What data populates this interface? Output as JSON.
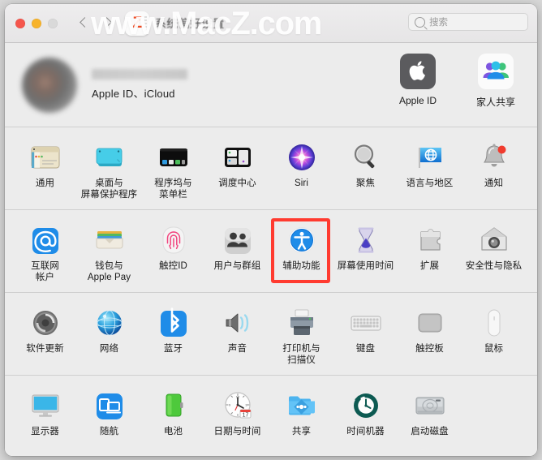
{
  "window": {
    "title": "系统偏好设置",
    "watermark": "www.MacZ.com",
    "logo_letter": "Z",
    "traffic_lights": [
      "close",
      "minimize",
      "zoom"
    ],
    "nav": {
      "back": "back-chevron",
      "forward": "forward-chevron"
    }
  },
  "search": {
    "placeholder": "搜索",
    "value": ""
  },
  "account": {
    "name": "",
    "subtitle": "Apple ID、iCloud",
    "shortcuts": [
      {
        "label": "Apple ID",
        "icon": "apple-logo-icon"
      },
      {
        "label": "家人共享",
        "icon": "family-sharing-icon"
      }
    ]
  },
  "sections": [
    {
      "name": "personal",
      "items": [
        {
          "label": "通用",
          "icon": "general-icon"
        },
        {
          "label": "桌面与\n屏幕保护程序",
          "icon": "desktop-screensaver-icon"
        },
        {
          "label": "程序坞与\n菜单栏",
          "icon": "dock-menubar-icon"
        },
        {
          "label": "调度中心",
          "icon": "mission-control-icon"
        },
        {
          "label": "Siri",
          "icon": "siri-icon"
        },
        {
          "label": "聚焦",
          "icon": "spotlight-icon"
        },
        {
          "label": "语言与地区",
          "icon": "language-region-icon"
        },
        {
          "label": "通知",
          "icon": "notifications-icon",
          "badge": true
        }
      ]
    },
    {
      "name": "accounts",
      "items": [
        {
          "label": "互联网\n帐户",
          "icon": "internet-accounts-icon"
        },
        {
          "label": "钱包与\nApple Pay",
          "icon": "wallet-applepay-icon"
        },
        {
          "label": "触控ID",
          "icon": "touch-id-icon"
        },
        {
          "label": "用户与群组",
          "icon": "users-groups-icon"
        },
        {
          "label": "辅助功能",
          "icon": "accessibility-icon",
          "highlighted": true
        },
        {
          "label": "屏幕使用时间",
          "icon": "screen-time-icon"
        },
        {
          "label": "扩展",
          "icon": "extensions-icon"
        },
        {
          "label": "安全性与隐私",
          "icon": "security-privacy-icon"
        }
      ]
    },
    {
      "name": "hardware",
      "items": [
        {
          "label": "软件更新",
          "icon": "software-update-icon"
        },
        {
          "label": "网络",
          "icon": "network-icon"
        },
        {
          "label": "蓝牙",
          "icon": "bluetooth-icon"
        },
        {
          "label": "声音",
          "icon": "sound-icon"
        },
        {
          "label": "打印机与\n扫描仪",
          "icon": "printers-scanners-icon"
        },
        {
          "label": "键盘",
          "icon": "keyboard-icon"
        },
        {
          "label": "触控板",
          "icon": "trackpad-icon"
        },
        {
          "label": "鼠标",
          "icon": "mouse-icon"
        }
      ]
    },
    {
      "name": "system",
      "items": [
        {
          "label": "显示器",
          "icon": "displays-icon"
        },
        {
          "label": "随航",
          "icon": "sidecar-icon"
        },
        {
          "label": "电池",
          "icon": "battery-icon"
        },
        {
          "label": "日期与时间",
          "icon": "date-time-icon",
          "day": "17"
        },
        {
          "label": "共享",
          "icon": "sharing-icon"
        },
        {
          "label": "时间机器",
          "icon": "time-machine-icon"
        },
        {
          "label": "启动磁盘",
          "icon": "startup-disk-icon"
        }
      ]
    }
  ],
  "colors": {
    "highlight": "#ff3b30",
    "window_bg": "#ececec",
    "titlebar_bg": "#e8e7e8",
    "accent_blue": "#1f8ce8"
  }
}
